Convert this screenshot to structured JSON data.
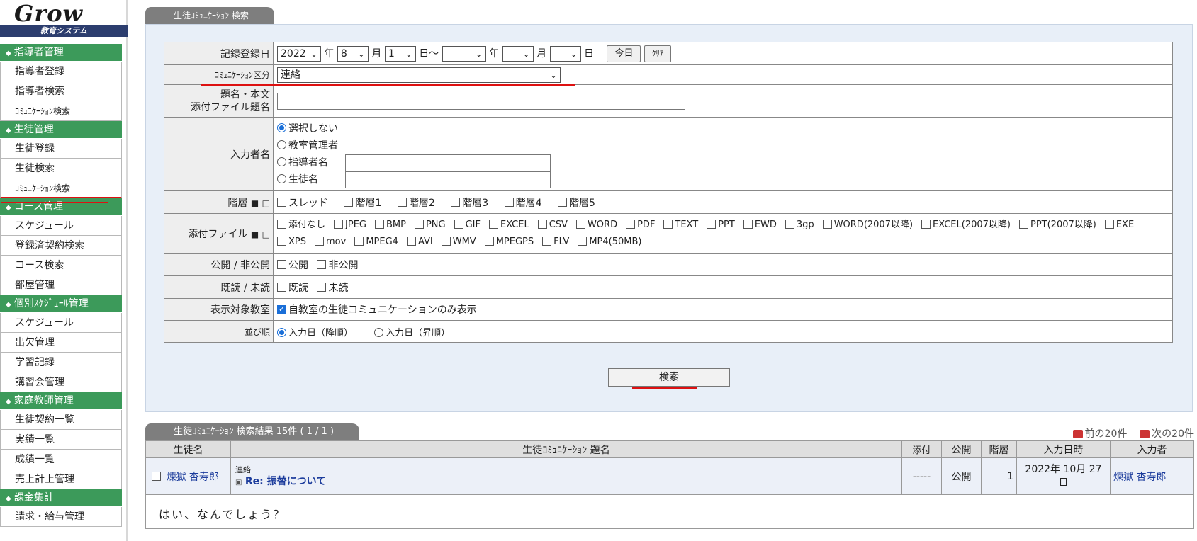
{
  "sidebar": {
    "logo": "Grow",
    "logo_sub": "教育システム",
    "sections": [
      {
        "title": "指導者管理",
        "items": [
          "指導者登録",
          "指導者検索",
          "ｺﾐｭﾆｹｰｼｮﾝ検索"
        ]
      },
      {
        "title": "生徒管理",
        "items": [
          "生徒登録",
          "生徒検索",
          "ｺﾐｭﾆｹｰｼｮﾝ検索"
        ]
      },
      {
        "title": "コース管理",
        "items": [
          "スケジュール",
          "登録済契約検索",
          "コース検索",
          "部屋管理"
        ]
      },
      {
        "title": "個別ｽｹｼﾞｭｰﾙ管理",
        "items": [
          "スケジュール",
          "出欠管理",
          "学習記録",
          "講習会管理"
        ]
      },
      {
        "title": "家庭教師管理",
        "items": [
          "生徒契約一覧",
          "実績一覧",
          "成績一覧",
          "売上計上管理"
        ]
      },
      {
        "title": "課金集計",
        "items": [
          "請求・給与管理"
        ]
      }
    ]
  },
  "search_panel": {
    "tab_label": "生徒ｺﾐｭﾆｹｰｼｮﾝ 検索",
    "record_date": {
      "label": "記録登録日",
      "from_year": "2022",
      "from_month": "8",
      "from_day": "1",
      "to_year": "",
      "to_month": "",
      "to_day": "",
      "unit_year": "年",
      "unit_month": "月",
      "unit_day": "日",
      "tilde": "～",
      "today_button": "今日",
      "clear_button": "ｸﾘｱ"
    },
    "communication_type": {
      "label": "ｺﾐｭﾆｹｰｼｮﾝ区分",
      "value": "連絡"
    },
    "title_body": {
      "label_line1": "題名・本文",
      "label_line2": "添付ファイル題名",
      "value": ""
    },
    "author": {
      "label": "入力者名",
      "options": [
        "選択しない",
        "教室管理者",
        "指導者名",
        "生徒名"
      ],
      "selected": "選択しない",
      "instructor_name": "",
      "student_name": ""
    },
    "hierarchy": {
      "label": "階層",
      "options": [
        "スレッド",
        "階層1",
        "階層2",
        "階層3",
        "階層4",
        "階層5"
      ]
    },
    "attachments": {
      "label": "添付ファイル",
      "options": [
        "添付なし",
        "JPEG",
        "BMP",
        "PNG",
        "GIF",
        "EXCEL",
        "CSV",
        "WORD",
        "PDF",
        "TEXT",
        "PPT",
        "EWD",
        "3gp",
        "WORD(2007以降)",
        "EXCEL(2007以降)",
        "PPT(2007以降)",
        "EXE",
        "XPS",
        "mov",
        "MPEG4",
        "AVI",
        "WMV",
        "MPEGPS",
        "FLV",
        "MP4(50MB)"
      ]
    },
    "publish": {
      "label": "公開 / 非公開",
      "options": [
        "公開",
        "非公開"
      ]
    },
    "read": {
      "label": "既読 / 未読",
      "options": [
        "既読",
        "未読"
      ]
    },
    "target_class": {
      "label": "表示対象教室",
      "option": "自教室の生徒コミュニケーションのみ表示",
      "checked": true
    },
    "sort": {
      "label": "並び順",
      "options": [
        "入力日（降順）",
        "入力日（昇順）"
      ],
      "selected": "入力日（降順）"
    },
    "search_button": "検索"
  },
  "results": {
    "tab_label": "生徒ｺﾐｭﾆｹｰｼｮﾝ 検索結果 15件 ( 1 / 1 )",
    "prev_label": "前の20件",
    "next_label": "次の20件",
    "columns": [
      "生徒名",
      "生徒ｺﾐｭﾆｹｰｼｮﾝ 題名",
      "添付",
      "公開",
      "階層",
      "入力日時",
      "入力者"
    ],
    "rows": [
      {
        "student": "煉獄 杏寿郎",
        "category": "連絡",
        "title": "Re: 振替について",
        "attachment": "-----",
        "publish": "公開",
        "level": "1",
        "date": "2022年 10月 27日",
        "author": "煉獄 杏寿郎",
        "body": "はい、なんでしょう？"
      }
    ]
  },
  "colors": {
    "sidebar_section": "#3c9a5a",
    "logo_bar": "#2c3d6e",
    "panel_bg": "#e8eff8",
    "accent_red": "#dd1111",
    "link": "#1c3c9c"
  }
}
